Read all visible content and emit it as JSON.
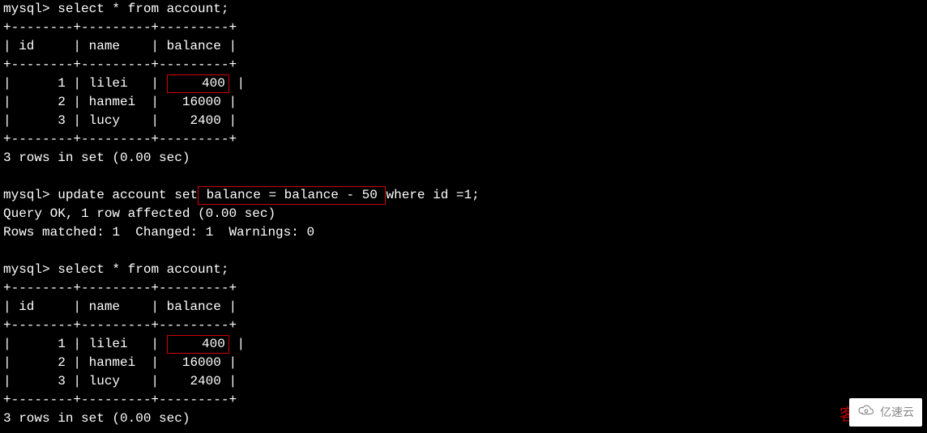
{
  "prompt": "mysql>",
  "queries": {
    "q1": "select * from account;",
    "q2_pre": "update account set",
    "q2_mid": " balance = balance - 50 ",
    "q2_post": "where id =1;",
    "q3": "select * from account;"
  },
  "sep": {
    "border": "+--------+---------+---------+",
    "header": "| id     | name    | balance |"
  },
  "rows1": [
    {
      "id": "1",
      "name": "lilei",
      "bal": "400",
      "hl": true
    },
    {
      "id": "2",
      "name": "hanmei",
      "bal": "16000",
      "hl": false
    },
    {
      "id": "3",
      "name": "lucy",
      "bal": "2400",
      "hl": false
    }
  ],
  "rows2": [
    {
      "id": "1",
      "name": "lilei",
      "bal": "400",
      "hl": true
    },
    {
      "id": "2",
      "name": "hanmei",
      "bal": "16000",
      "hl": false
    },
    {
      "id": "3",
      "name": "lucy",
      "bal": "2400",
      "hl": false
    }
  ],
  "msgs": {
    "rowsInSet": "3 rows in set (0.00 sec)",
    "queryOk": "Query OK, 1 row affected (0.00 sec)",
    "matched": "Rows matched: 1  Changed: 1  Warnings: 0"
  },
  "watermark": {
    "text": "亿速云",
    "partial": "客"
  }
}
